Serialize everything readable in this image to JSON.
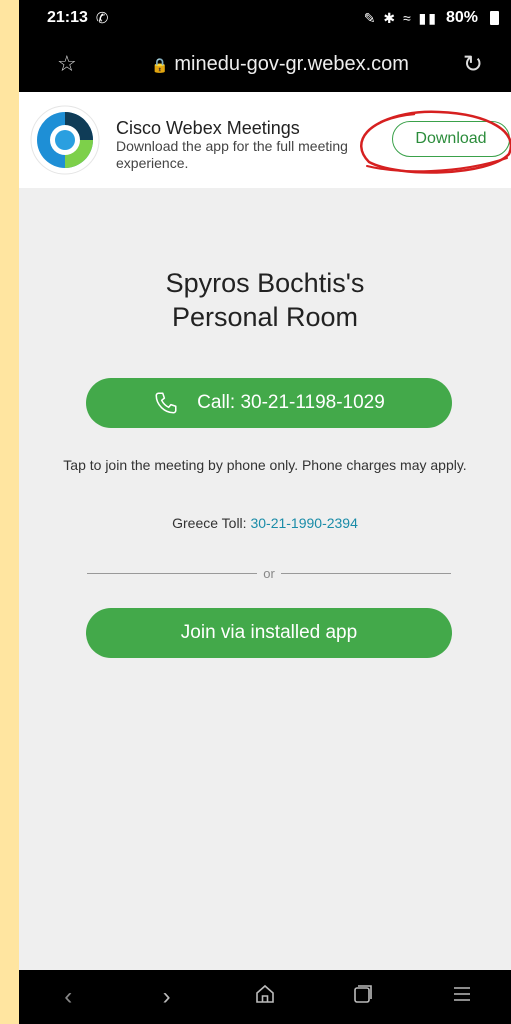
{
  "status_bar": {
    "time": "21:13",
    "battery": "80%",
    "icons": [
      "viber-icon",
      "mute-icon",
      "bluetooth-icon",
      "wifi-icon",
      "volte-icon",
      "signal-icon"
    ]
  },
  "browser": {
    "url": "minedu-gov-gr.webex.com"
  },
  "banner": {
    "app_name": "Cisco Webex Meetings",
    "description": "Download the app for the full meeting experience.",
    "download_label": "Download"
  },
  "meeting": {
    "title_line1": "Spyros Bochtis's",
    "title_line2": "Personal Room",
    "call_label": "Call: 30-21-1198-1029",
    "phone_info": "Tap to join the meeting by phone only. Phone charges may apply.",
    "toll_label": "Greece Toll: ",
    "toll_number": "30-21-1990-2394",
    "or_text": "or",
    "join_label": "Join via installed app"
  },
  "colors": {
    "accent_green": "#43a94a",
    "link_blue": "#1a8ca8",
    "annotation_red": "#d62020",
    "background": "#efefef"
  }
}
